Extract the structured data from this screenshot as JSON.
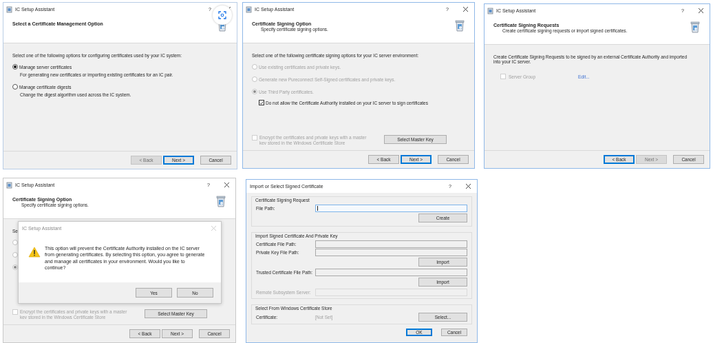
{
  "windows": [
    {
      "kind": "wizard",
      "title": "IC Setup Assistant",
      "help": "?",
      "capture_overlay": true,
      "heading": "Select a Certificate Management Option",
      "intro": "Select one of the following options for configuring certificates used by your IC system:",
      "items": [
        {
          "kind": "radio",
          "label": "Manage server certificates",
          "description": "For generating new certificates or importing existing certificates for an IC pair.",
          "selected": true,
          "disabled": false
        },
        {
          "kind": "radio",
          "label": "Manage certificate digests",
          "description": "Change the digest algorithm used across the IC system.",
          "selected": false,
          "disabled": false
        }
      ],
      "buttons": [
        {
          "label": "< Back",
          "disabled": true,
          "default": false
        },
        {
          "label": "Next >",
          "disabled": false,
          "default": true
        },
        {
          "label": "Cancel",
          "disabled": false,
          "default": false
        }
      ]
    },
    {
      "kind": "wizard",
      "title": "IC Setup Assistant",
      "help": "?",
      "heading": "Certificate Signing Option",
      "subtitle": "Specify certificate signing options.",
      "intro": "Select one of the following certificate signing options for your IC server environment:",
      "items": [
        {
          "kind": "radio",
          "label": "Use existing certificates and private keys.",
          "selected": false,
          "disabled": true
        },
        {
          "kind": "radio",
          "label": "Generate new Pureconnect Self-Signed certificates and private keys.",
          "selected": false,
          "disabled": true
        },
        {
          "kind": "radio",
          "label": "Use Third Party certificates.",
          "selected": true,
          "disabled": true,
          "children": [
            {
              "kind": "checkbox",
              "label": "Do not allow the Certificate Authority installed on your IC server to sign certificates",
              "checked": true,
              "disabled": false
            }
          ]
        }
      ],
      "key_row": {
        "label": "Encrypt the certificates and private keys with a master kev stored in the Windows Certificate Store",
        "checked": false,
        "disabled": true,
        "button": "Select Master Key"
      },
      "buttons": [
        {
          "label": "< Back",
          "disabled": false,
          "default": false
        },
        {
          "label": "Next >",
          "disabled": false,
          "default": true
        },
        {
          "label": "Cancel",
          "disabled": false,
          "default": false
        }
      ]
    },
    {
      "kind": "wizard",
      "title": "IC Setup Assistant",
      "help": "?",
      "heading": "Certificate Signing Requests",
      "subtitle": "Create certificate signing requests or import signed certificates.",
      "intro": "Create Certificate Signing Requests to be signed by an external Certificate Authority and imported into your IC server.",
      "items": [
        {
          "kind": "link-checkbox",
          "label": "Server Group",
          "checked": false,
          "disabled": true,
          "link": "Edit..."
        }
      ],
      "buttons": [
        {
          "label": "< Back",
          "disabled": false,
          "default": true
        },
        {
          "label": "Next >",
          "disabled": true,
          "default": false
        },
        {
          "label": "Cancel",
          "disabled": false,
          "default": false
        }
      ]
    },
    {
      "kind": "wizard",
      "title": "IC Setup Assistant",
      "help": "?",
      "heading": "Certificate Signing Option",
      "subtitle": "Specify certificate signing options.",
      "intro": "Se",
      "items": [
        {
          "kind": "radio",
          "selected": false,
          "disabled": true
        },
        {
          "kind": "radio",
          "selected": false,
          "disabled": true
        },
        {
          "kind": "radio",
          "selected": true,
          "disabled": true
        }
      ],
      "key_row": {
        "label": "Encrypt the certificates and private keys with a master kev stored in the Windows Certificate Store",
        "checked": false,
        "disabled": true,
        "button": "Select Master Key"
      },
      "message_box": {
        "title": "IC Setup Assistant",
        "message": "This option will prevent the Certificate Authority installed on the IC server from generating certificates.  By selecting this option, you agree to generate and manage all certificates in your environment.  Would you like to continue?",
        "buttons": [
          {
            "label": "Yes"
          },
          {
            "label": "No"
          }
        ]
      },
      "buttons": [
        {
          "label": "< Back",
          "disabled": false,
          "default": false
        },
        {
          "label": "Next >",
          "disabled": false,
          "default": false
        },
        {
          "label": "Cancel",
          "disabled": false,
          "default": false
        }
      ]
    },
    {
      "kind": "form",
      "title": "Import or Select Signed Certificate",
      "help": "?",
      "groups": [
        {
          "title": "Certificate Signing Request",
          "rows": [
            {
              "kind": "field",
              "label": "File Path:",
              "focused": true,
              "disabled": false
            },
            {
              "kind": "button",
              "label": "Create"
            }
          ]
        },
        {
          "title": "Import Signed Certificate And Private Key",
          "rows": [
            {
              "kind": "field",
              "label": "Certificate File Path:",
              "focused": false,
              "disabled": false
            },
            {
              "kind": "field",
              "label": "Private Key File Path:",
              "focused": false,
              "disabled": false
            },
            {
              "kind": "button",
              "label": "Import"
            },
            {
              "kind": "field",
              "label": "Trusted Certificate File Path:",
              "focused": false,
              "disabled": false
            },
            {
              "kind": "button",
              "label": "Import"
            },
            {
              "kind": "field",
              "label": "Remote Subsystem Server:",
              "focused": false,
              "disabled": true
            }
          ]
        },
        {
          "title": "Select From Windows Certificate Store",
          "rows": [
            {
              "kind": "value",
              "label": "Certificate:",
              "value": "[Not Set]",
              "button": "Select..."
            }
          ]
        }
      ],
      "buttons": [
        {
          "label": "OK",
          "disabled": false,
          "default": true
        },
        {
          "label": "Cancel",
          "disabled": false,
          "default": false
        }
      ]
    }
  ]
}
